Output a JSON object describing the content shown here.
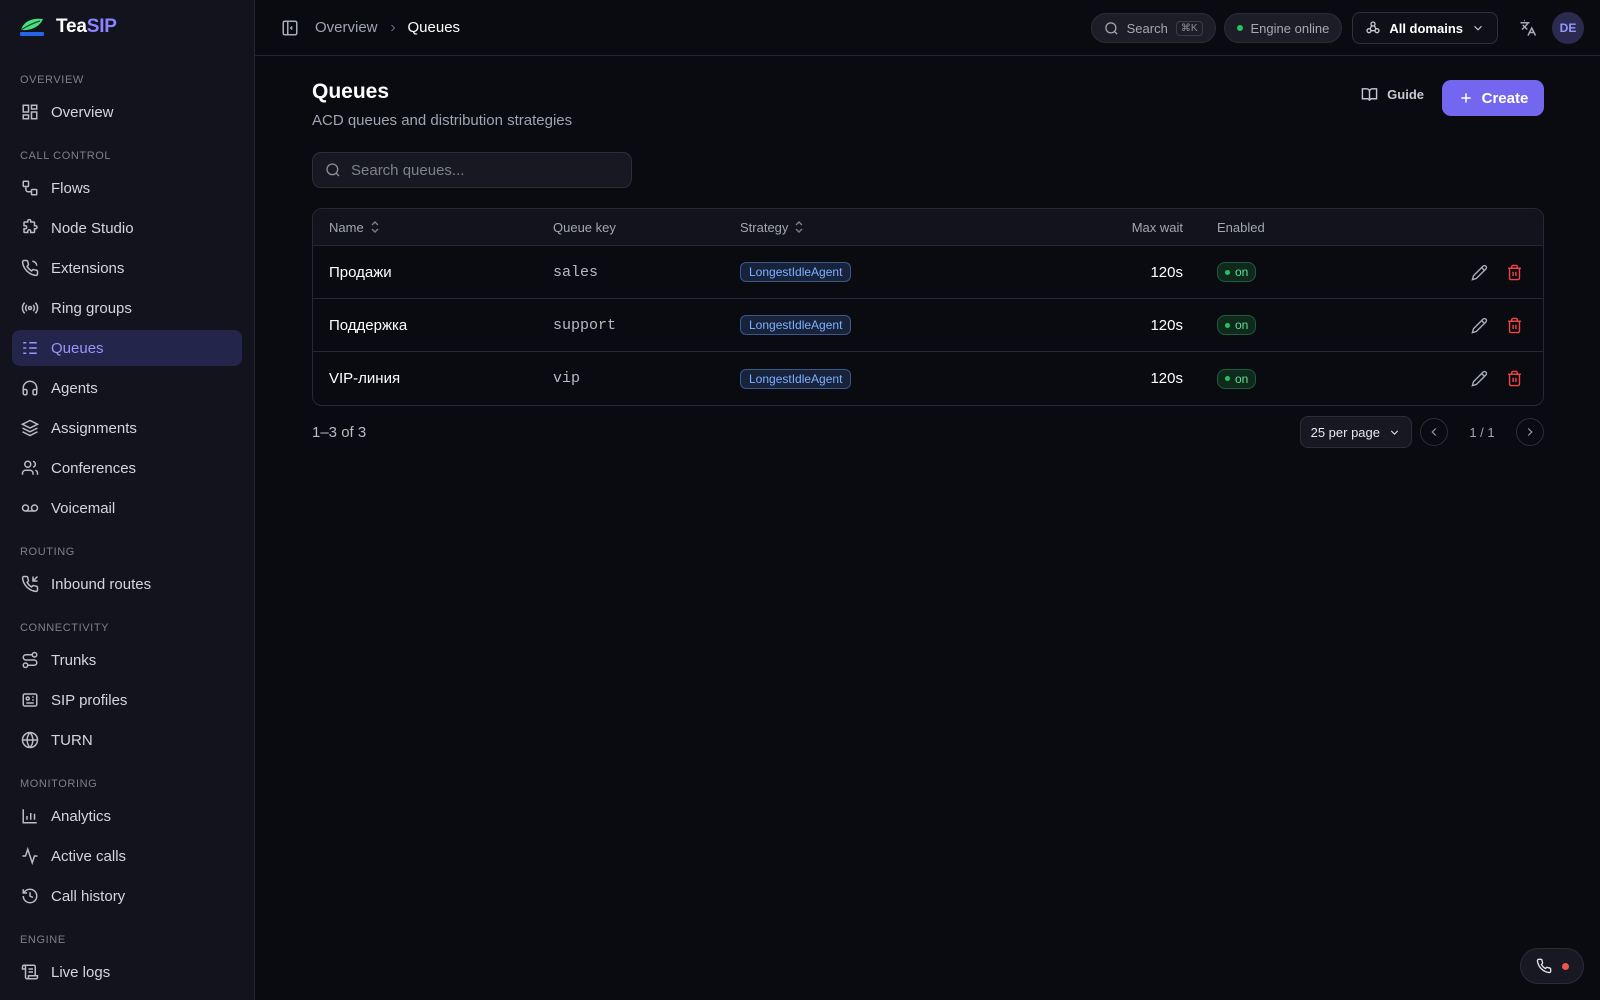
{
  "brand": {
    "name_part1": "Tea",
    "name_part2": "SIP"
  },
  "sidebar": {
    "sections": [
      {
        "title": "OVERVIEW",
        "items": [
          {
            "label": "Overview",
            "icon": "grid-icon"
          }
        ]
      },
      {
        "title": "CALL CONTROL",
        "items": [
          {
            "label": "Flows",
            "icon": "flow-icon"
          },
          {
            "label": "Node Studio",
            "icon": "puzzle-icon"
          },
          {
            "label": "Extensions",
            "icon": "phone-icon"
          },
          {
            "label": "Ring groups",
            "icon": "radio-icon"
          },
          {
            "label": "Queues",
            "icon": "list-icon",
            "active": true
          },
          {
            "label": "Agents",
            "icon": "headset-icon"
          },
          {
            "label": "Assignments",
            "icon": "layers-icon"
          },
          {
            "label": "Conferences",
            "icon": "users-icon"
          },
          {
            "label": "Voicemail",
            "icon": "voicemail-icon"
          }
        ]
      },
      {
        "title": "ROUTING",
        "items": [
          {
            "label": "Inbound routes",
            "icon": "phone-incoming-icon"
          }
        ]
      },
      {
        "title": "CONNECTIVITY",
        "items": [
          {
            "label": "Trunks",
            "icon": "route-icon"
          },
          {
            "label": "SIP profiles",
            "icon": "id-card-icon"
          },
          {
            "label": "TURN",
            "icon": "globe-icon"
          }
        ]
      },
      {
        "title": "MONITORING",
        "items": [
          {
            "label": "Analytics",
            "icon": "bar-chart-icon"
          },
          {
            "label": "Active calls",
            "icon": "activity-icon"
          },
          {
            "label": "Call history",
            "icon": "history-icon"
          }
        ]
      },
      {
        "title": "ENGINE",
        "items": [
          {
            "label": "Live logs",
            "icon": "scroll-icon"
          }
        ]
      }
    ]
  },
  "topbar": {
    "breadcrumb": [
      "Overview",
      "Queues"
    ],
    "search_label": "Search",
    "search_shortcut": "⌘K",
    "engine_status": "Engine online",
    "domain_selector": "All domains",
    "avatar_initials": "DE"
  },
  "page": {
    "title": "Queues",
    "subtitle": "ACD queues and distribution strategies",
    "guide_label": "Guide",
    "create_label": "Create",
    "search_placeholder": "Search queues..."
  },
  "table": {
    "columns": {
      "name": "Name",
      "queue_key": "Queue key",
      "strategy": "Strategy",
      "max_wait": "Max wait",
      "enabled": "Enabled"
    },
    "rows": [
      {
        "name": "Продажи",
        "queue_key": "sales",
        "strategy": "LongestIdleAgent",
        "max_wait": "120s",
        "enabled": "on"
      },
      {
        "name": "Поддержка",
        "queue_key": "support",
        "strategy": "LongestIdleAgent",
        "max_wait": "120s",
        "enabled": "on"
      },
      {
        "name": "VIP-линия",
        "queue_key": "vip",
        "strategy": "LongestIdleAgent",
        "max_wait": "120s",
        "enabled": "on"
      }
    ]
  },
  "pagination": {
    "range": "1–3 of 3",
    "per_page": "25 per page",
    "page_indicator": "1 / 1"
  },
  "colors": {
    "accent": "#7367f0",
    "active_nav_bg": "#23254a",
    "success": "#22c55e",
    "danger": "#ef4444",
    "strategy_badge": "#7fb0ff"
  }
}
